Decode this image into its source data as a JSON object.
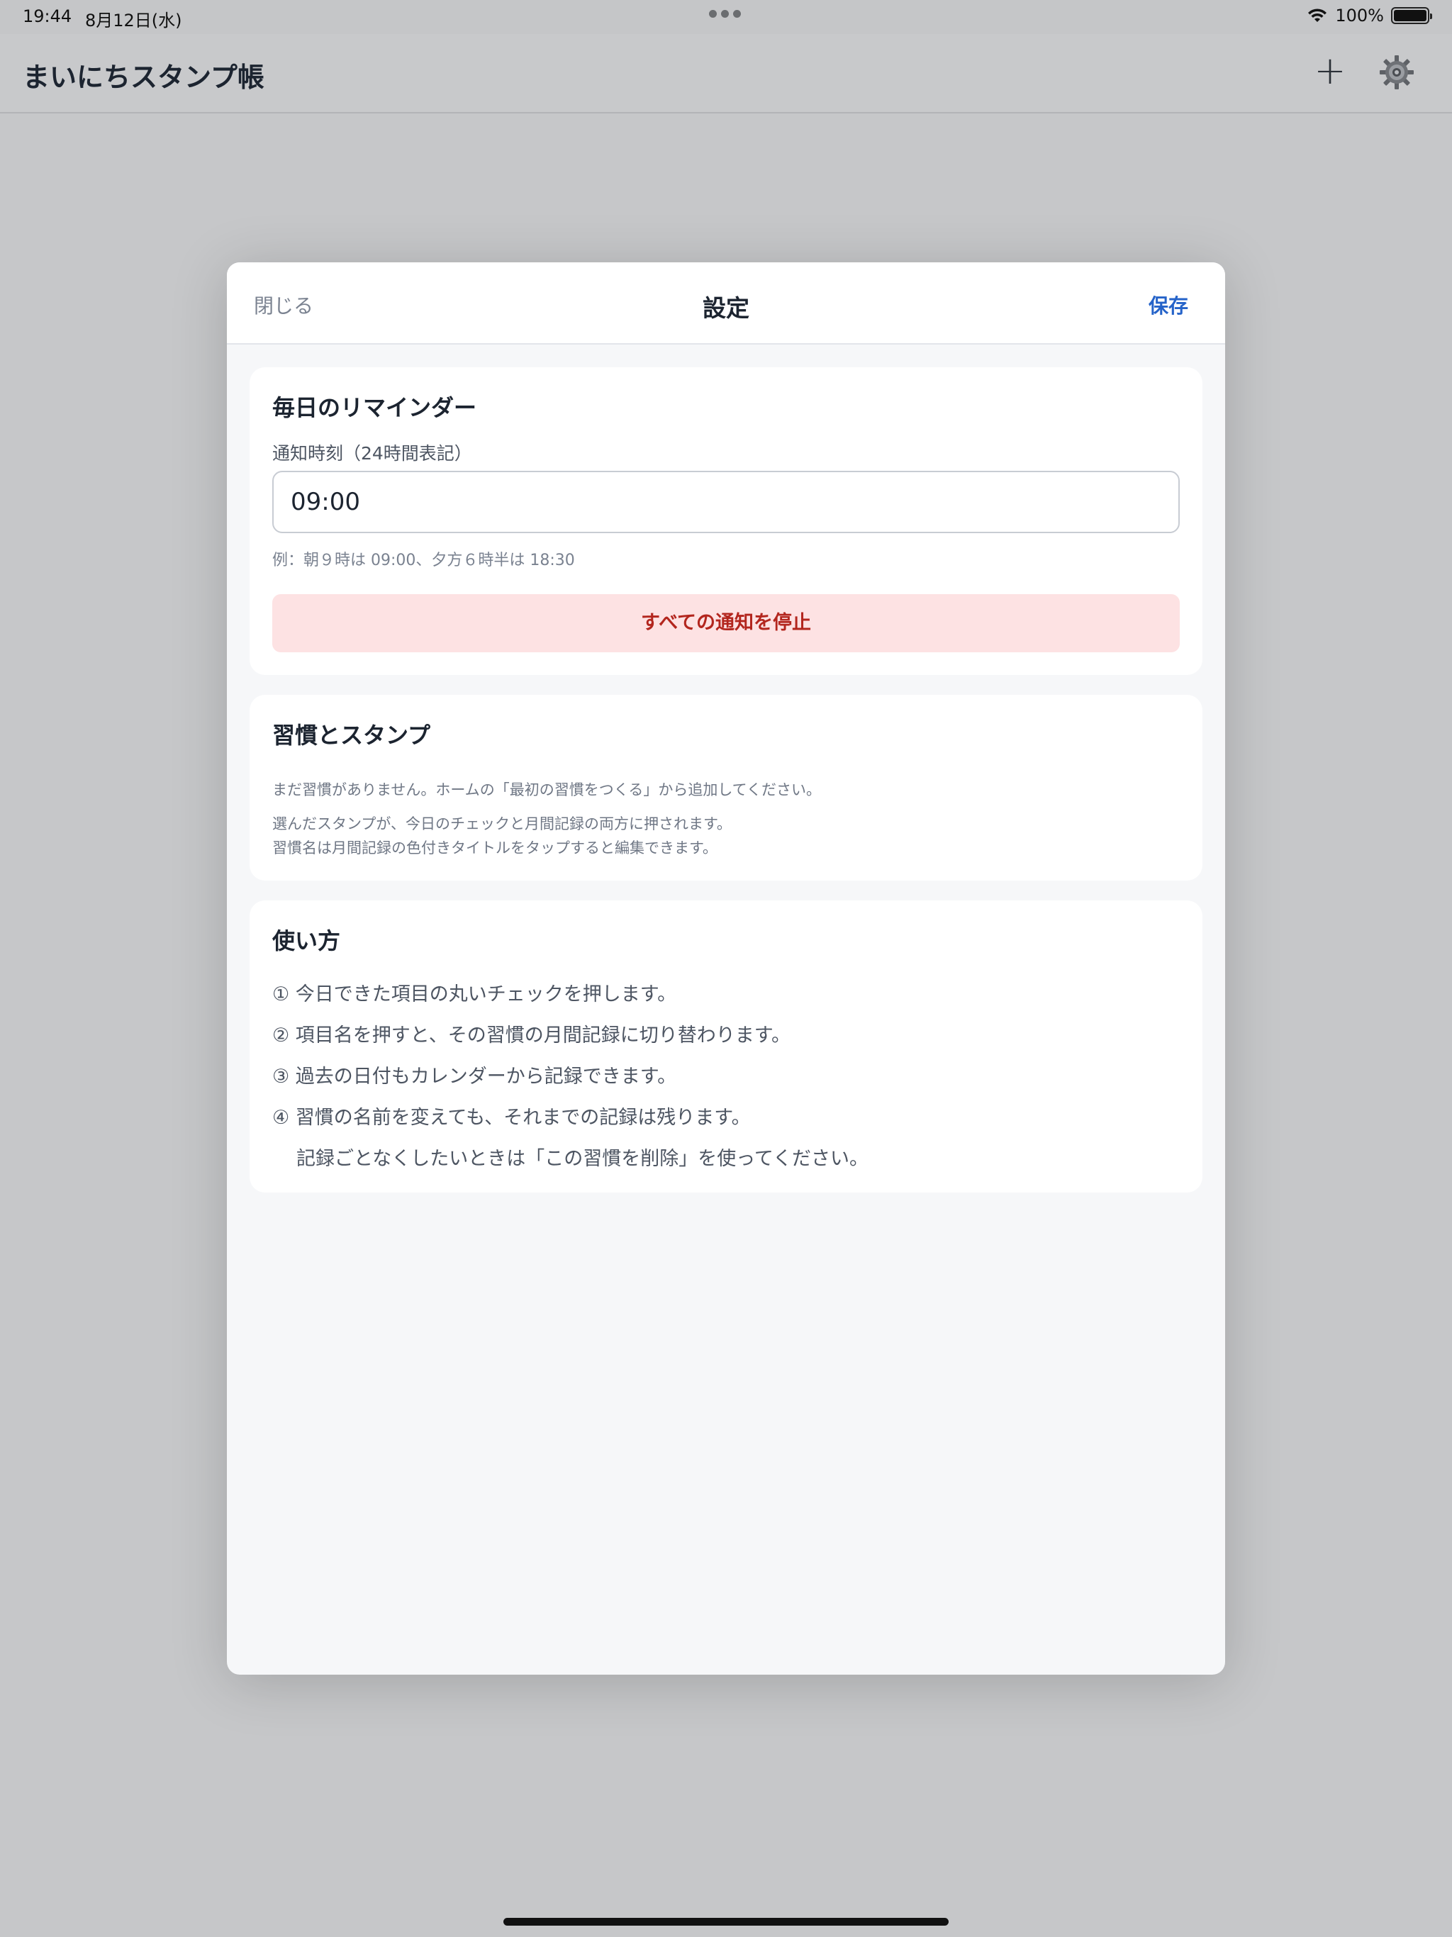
{
  "status_bar": {
    "time": "19:44",
    "date": "8月12日(水)",
    "battery": "100%"
  },
  "nav": {
    "title": "まいにちスタンプ帳",
    "add_label": "+",
    "add_icon": "plus-icon",
    "settings_icon": "gear-icon"
  },
  "modal": {
    "close_label": "閉じる",
    "title": "設定",
    "save_label": "保存"
  },
  "reminder": {
    "title": "毎日のリマインダー",
    "field_label": "通知時刻（24時間表記）",
    "time_value": "09:00",
    "hint": "例：朝９時は 09:00、夕方６時半は 18:30",
    "stop_label": "すべての通知を停止"
  },
  "habits": {
    "title": "習慣とスタンプ",
    "empty_text": "まだ習慣がありません。ホームの「最初の習慣をつくる」から追加してください。",
    "note1": "選んだスタンプが、今日のチェックと月間記録の両方に押されます。",
    "note2": "習慣名は月間記録の色付きタイトルをタップすると編集できます。"
  },
  "howto": {
    "title": "使い方",
    "items": [
      "① 今日できた項目の丸いチェックを押します。",
      "② 項目名を押すと、その習慣の月間記録に切り替わります。",
      "③ 過去の日付もカレンダーから記録できます。",
      "④ 習慣の名前を変えても、それまでの記録は残ります。",
      "記録ごとなくしたいときは「この習慣を削除」を使ってください。"
    ]
  },
  "colors": {
    "accent": "#2563c9",
    "danger_text": "#b3261e",
    "danger_bg": "#fde2e3"
  }
}
